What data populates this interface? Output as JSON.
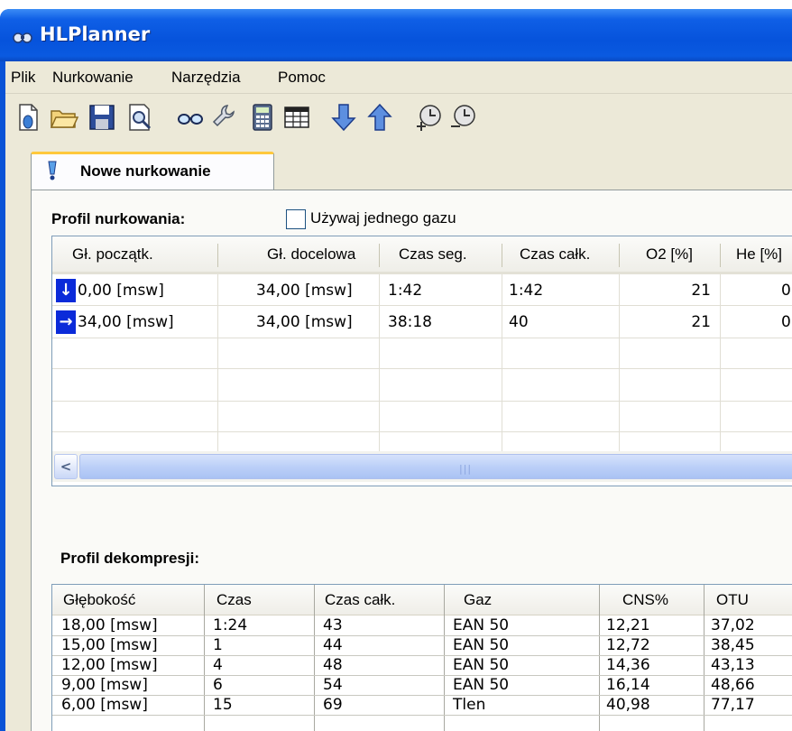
{
  "window": {
    "title": "HLPlanner"
  },
  "menu": {
    "items": [
      "Plik",
      "Nurkowanie",
      "Narzędzia",
      "Pomoc"
    ]
  },
  "toolbar": {
    "buttons": [
      "new-file-icon",
      "open-folder-icon",
      "save-icon",
      "print-preview-icon",
      "goggles-icon",
      "wrench-icon",
      "calculator-icon",
      "table-icon",
      "arrow-down-icon",
      "arrow-up-icon",
      "clock-plus-icon",
      "clock-minus-icon"
    ]
  },
  "tab": {
    "label": "Nowe nurkowanie"
  },
  "profile": {
    "label": "Profil nurkowania:",
    "single_gas_label": "Używaj jednego gazu",
    "single_gas_checked": false,
    "columns": [
      "Gł. początk.",
      "Gł. docelowa",
      "Czas seg.",
      "Czas całk.",
      "O2 [%]",
      "He [%]"
    ],
    "rows": [
      {
        "direction": "down",
        "start": "0,00 [msw]",
        "target": "34,00 [msw]",
        "seg": "1:42",
        "total": "1:42",
        "o2": "21",
        "he": "0"
      },
      {
        "direction": "level",
        "start": "34,00 [msw]",
        "target": "34,00 [msw]",
        "seg": "38:18",
        "total": "40",
        "o2": "21",
        "he": "0"
      }
    ]
  },
  "deco": {
    "label": "Profil dekompresji:",
    "columns": [
      "Głębokość",
      "Czas",
      "Czas całk.",
      "Gaz",
      "CNS%",
      "OTU"
    ],
    "rows": [
      [
        "18,00 [msw]",
        "1:24",
        "43",
        "EAN 50",
        "12,21",
        "37,02"
      ],
      [
        "15,00 [msw]",
        "1",
        "44",
        "EAN 50",
        "12,72",
        "38,45"
      ],
      [
        "12,00 [msw]",
        "4",
        "48",
        "EAN 50",
        "14,36",
        "43,13"
      ],
      [
        "9,00 [msw]",
        "6",
        "54",
        "EAN 50",
        "16,14",
        "48,66"
      ],
      [
        "6,00 [msw]",
        "15",
        "69",
        "Tlen",
        "40,98",
        "77,17"
      ]
    ]
  },
  "colors": {
    "titlebar": "#0a53d6",
    "face": "#ece9d8",
    "tab_accent": "#ffc83c",
    "arrow_box": "#0b2bd9"
  }
}
